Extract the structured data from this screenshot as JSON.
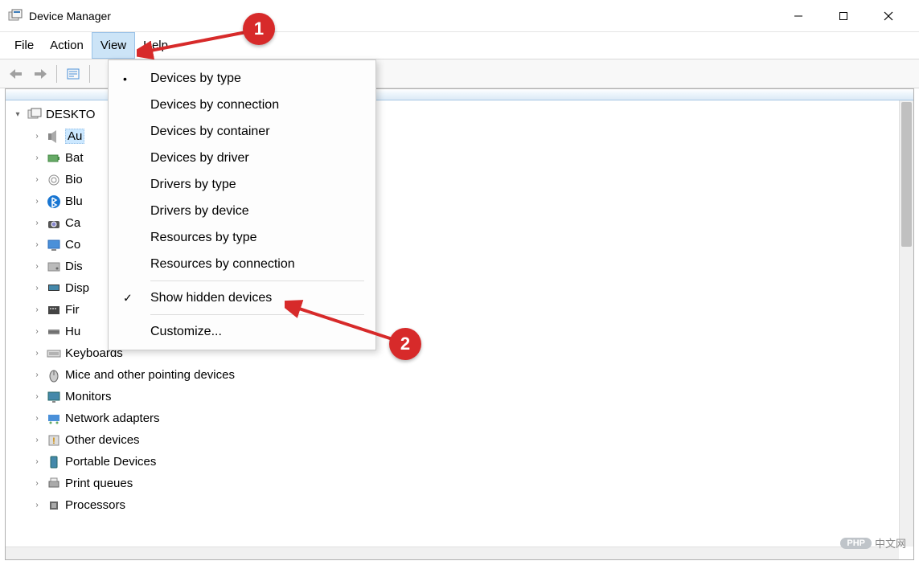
{
  "window": {
    "title": "Device Manager"
  },
  "menubar": {
    "items": [
      "File",
      "Action",
      "View",
      "Help"
    ],
    "active_index": 2
  },
  "view_menu": {
    "items": [
      {
        "label": "Devices by type",
        "mark": "dot"
      },
      {
        "label": "Devices by connection",
        "mark": ""
      },
      {
        "label": "Devices by container",
        "mark": ""
      },
      {
        "label": "Devices by driver",
        "mark": ""
      },
      {
        "label": "Drivers by type",
        "mark": ""
      },
      {
        "label": "Drivers by device",
        "mark": ""
      },
      {
        "label": "Resources by type",
        "mark": ""
      },
      {
        "label": "Resources by connection",
        "mark": ""
      }
    ],
    "sep1": true,
    "items2": [
      {
        "label": "Show hidden devices",
        "mark": "check"
      }
    ],
    "sep2": true,
    "items3": [
      {
        "label": "Customize...",
        "mark": ""
      }
    ]
  },
  "tree": {
    "root": {
      "label": "DESKTO",
      "expanded": true
    },
    "children": [
      {
        "label": "Au",
        "full": "Audio inputs and outputs",
        "icon": "audio-icon",
        "selected": true
      },
      {
        "label": "Bat",
        "full": "Batteries",
        "icon": "battery-icon"
      },
      {
        "label": "Bio",
        "full": "Biometric devices",
        "icon": "fingerprint-icon"
      },
      {
        "label": "Blu",
        "full": "Bluetooth",
        "icon": "bluetooth-icon"
      },
      {
        "label": "Ca",
        "full": "Cameras",
        "icon": "camera-icon"
      },
      {
        "label": "Co",
        "full": "Computer",
        "icon": "computer-icon"
      },
      {
        "label": "Dis",
        "full": "Disk drives",
        "icon": "disk-icon"
      },
      {
        "label": "Disp",
        "full": "Display adapters",
        "icon": "display-icon"
      },
      {
        "label": "Fir",
        "full": "Firmware",
        "icon": "firmware-icon"
      },
      {
        "label": "Hu",
        "full": "Human Interface Devices",
        "icon": "hid-icon"
      },
      {
        "label": "Keyboards",
        "icon": "keyboard-icon"
      },
      {
        "label": "Mice and other pointing devices",
        "icon": "mouse-icon"
      },
      {
        "label": "Monitors",
        "icon": "monitor-icon"
      },
      {
        "label": "Network adapters",
        "icon": "network-icon"
      },
      {
        "label": "Other devices",
        "icon": "other-icon"
      },
      {
        "label": "Portable Devices",
        "icon": "portable-icon"
      },
      {
        "label": "Print queues",
        "icon": "printer-icon"
      },
      {
        "label": "Processors",
        "icon": "processor-icon"
      }
    ]
  },
  "annotations": {
    "callouts": [
      "1",
      "2"
    ]
  },
  "watermark": {
    "badge": "PHP",
    "text": "中文网"
  }
}
